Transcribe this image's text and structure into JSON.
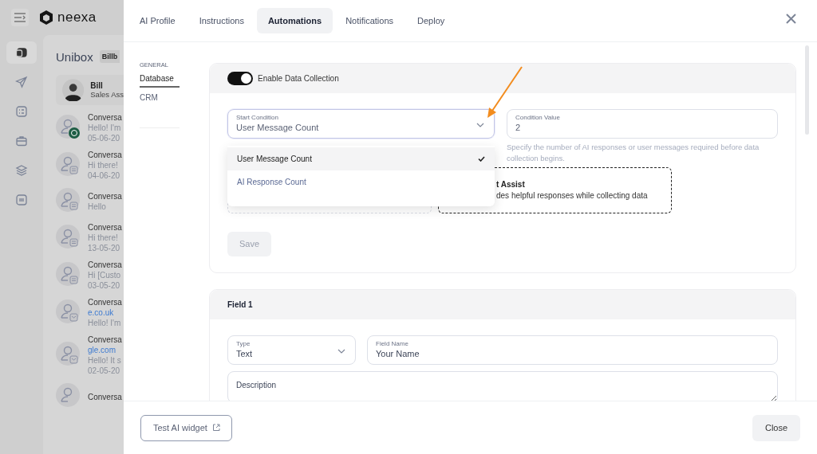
{
  "app": {
    "logo": "neexa",
    "nav": [
      {
        "kind": "inbox",
        "selected": true
      },
      {
        "kind": "send",
        "selected": false
      },
      {
        "kind": "tasks",
        "selected": false
      },
      {
        "kind": "briefcase",
        "selected": false
      },
      {
        "kind": "layers",
        "selected": false
      },
      {
        "kind": "widget",
        "selected": false
      }
    ]
  },
  "unibox": {
    "title": "Unibox",
    "badge": "Billb",
    "agent": {
      "name": "Bill",
      "role": "Sales Ass"
    },
    "conversations": [
      {
        "kind": "whatsapp",
        "title": "Conversa",
        "lines": [
          {
            "kind": "text",
            "text": "Hello! I'm"
          },
          {
            "kind": "date",
            "text": "05-06-20"
          }
        ]
      },
      {
        "kind": "chat",
        "title": "Conversa",
        "lines": [
          {
            "kind": "text",
            "text": "Hi there!"
          },
          {
            "kind": "date",
            "text": "04-06-20"
          }
        ]
      },
      {
        "kind": "chat",
        "title": "Conversa",
        "lines": [
          {
            "kind": "text",
            "text": "Hello"
          }
        ]
      },
      {
        "kind": "chat",
        "title": "Conversa",
        "lines": [
          {
            "kind": "text",
            "text": "Hi there!"
          },
          {
            "kind": "date",
            "text": "13-05-20"
          }
        ]
      },
      {
        "kind": "chat",
        "title": "Conversa",
        "lines": [
          {
            "kind": "text",
            "text": "Hi [Custo"
          },
          {
            "kind": "date",
            "text": "03-05-20"
          }
        ]
      },
      {
        "kind": "mail",
        "title": "Conversa",
        "lines": [
          {
            "kind": "link",
            "text": "e.co.uk"
          },
          {
            "kind": "text",
            "text": "Hello! I'm"
          }
        ]
      },
      {
        "kind": "mail",
        "title": "Conversa",
        "lines": [
          {
            "kind": "link",
            "text": "gle.com"
          },
          {
            "kind": "text",
            "text": "Hello! It s"
          },
          {
            "kind": "date",
            "text": "02-05-20"
          }
        ]
      },
      {
        "kind": "none",
        "title": "Conversa"
      }
    ]
  },
  "modal": {
    "tabs": [
      {
        "label": "AI Profile",
        "selected": false
      },
      {
        "label": "Instructions",
        "selected": false
      },
      {
        "label": "Automations",
        "selected": true
      },
      {
        "label": "Notifications",
        "selected": false
      },
      {
        "label": "Deploy",
        "selected": false
      }
    ],
    "menu": {
      "heading": "GENERAL",
      "items": [
        {
          "label": "Database",
          "selected": true
        },
        {
          "label": "CRM",
          "selected": false
        }
      ]
    },
    "collection": {
      "enabled": true,
      "label": "Enable Data Collection",
      "start_condition": {
        "label": "Start Condition",
        "value": "User Message Count",
        "open": true,
        "options": [
          {
            "label": "User Message Count",
            "selected": true
          },
          {
            "label": "AI Response Count",
            "selected": false
          }
        ]
      },
      "condition_value": {
        "label": "Condition Value",
        "value": "2",
        "help": "Specify the number of AI responses or user messages required before data collection begins."
      },
      "modes": [
        {
          "selected": false
        },
        {
          "title": "t Assist",
          "description": "des helpful responses while collecting data",
          "selected": true
        }
      ],
      "save": "Save"
    },
    "field": {
      "heading": "Field 1",
      "type": {
        "label": "Type",
        "value": "Text"
      },
      "name": {
        "label": "Field Name",
        "value": "Your Name"
      },
      "description": {
        "placeholder": "Description"
      }
    },
    "footer": {
      "test": "Test AI widget",
      "close": "Close"
    }
  }
}
